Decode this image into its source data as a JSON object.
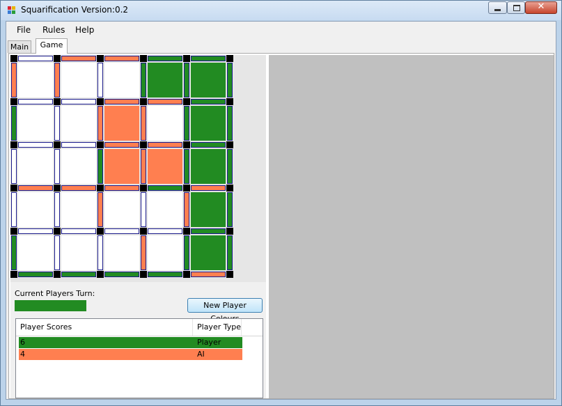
{
  "window": {
    "title": "Squarification Version:0.2",
    "close_glyph": "✕"
  },
  "menu": {
    "items": [
      "File",
      "Rules",
      "Help"
    ]
  },
  "tabs": [
    {
      "label": "Main",
      "active": false
    },
    {
      "label": "Game",
      "active": true
    }
  ],
  "colors": {
    "green": "#228b22",
    "orange": "#ff7f50",
    "white": "#ffffff",
    "edge_border": "#1a1a8c"
  },
  "board": {
    "rows": 5,
    "cols": 5,
    "h_lines": [
      [
        "W",
        "O",
        "O",
        "G",
        "G"
      ],
      [
        "W",
        "W",
        "O",
        "O",
        "G"
      ],
      [
        "W",
        "W",
        "O",
        "O",
        "G"
      ],
      [
        "O",
        "O",
        "O",
        "G",
        "O"
      ],
      [
        "W",
        "W",
        "W",
        "W",
        "G"
      ],
      [
        "G",
        "G",
        "G",
        "G",
        "O"
      ]
    ],
    "v_lines": [
      [
        "O",
        "O",
        "W",
        "G",
        "G",
        "G"
      ],
      [
        "G",
        "W",
        "O",
        "O",
        "G",
        "G"
      ],
      [
        "W",
        "W",
        "G",
        "O",
        "G",
        "G"
      ],
      [
        "W",
        "W",
        "O",
        "W",
        "O",
        "G"
      ],
      [
        "G",
        "W",
        "W",
        "O",
        "G",
        "G"
      ]
    ],
    "boxes": [
      [
        "W",
        "W",
        "W",
        "G",
        "G"
      ],
      [
        "W",
        "W",
        "O",
        "W",
        "G"
      ],
      [
        "W",
        "W",
        "O",
        "O",
        "G"
      ],
      [
        "W",
        "W",
        "W",
        "W",
        "G"
      ],
      [
        "W",
        "W",
        "W",
        "W",
        "G"
      ]
    ]
  },
  "turn": {
    "label": "Current Players Turn:",
    "color": "#228b22"
  },
  "new_colours_button": "New Player Colours",
  "scores": {
    "headers": [
      "Player Scores",
      "Player Type"
    ],
    "rows": [
      {
        "score": "6",
        "type": "Player",
        "color": "#228b22"
      },
      {
        "score": "4",
        "type": "AI",
        "color": "#ff7f50"
      }
    ]
  }
}
